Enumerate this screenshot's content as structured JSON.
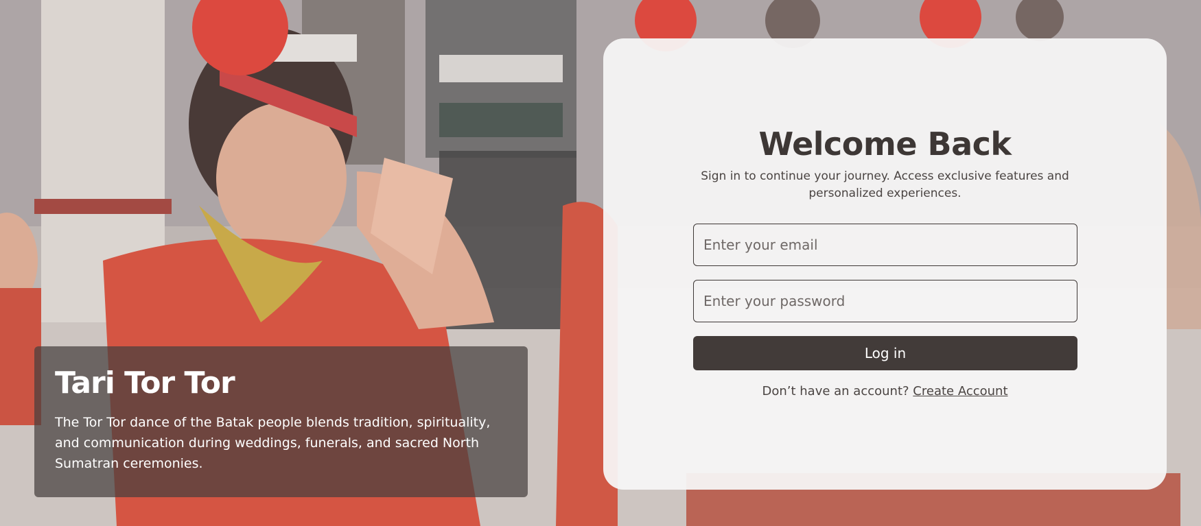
{
  "hero": {
    "title": "Tari Tor Tor",
    "description": "The Tor Tor dance of the Batak people blends tradition, spirituality, and communication during weddings, funerals, and sacred North Sumatran ceremonies."
  },
  "login": {
    "title": "Welcome Back",
    "subtitle": "Sign in to continue your journey. Access exclusive features and personalized experiences.",
    "email_placeholder": "Enter your email",
    "email_value": "",
    "password_placeholder": "Enter your password",
    "password_value": "",
    "submit_label": "Log in",
    "signup_prompt": "Don’t have an account?",
    "signup_link": "Create Account"
  },
  "colors": {
    "panel_bg": "#f7f5f5",
    "button_bg": "#423b39",
    "text_dark": "#3d3735",
    "caption_bg": "#46403e"
  }
}
